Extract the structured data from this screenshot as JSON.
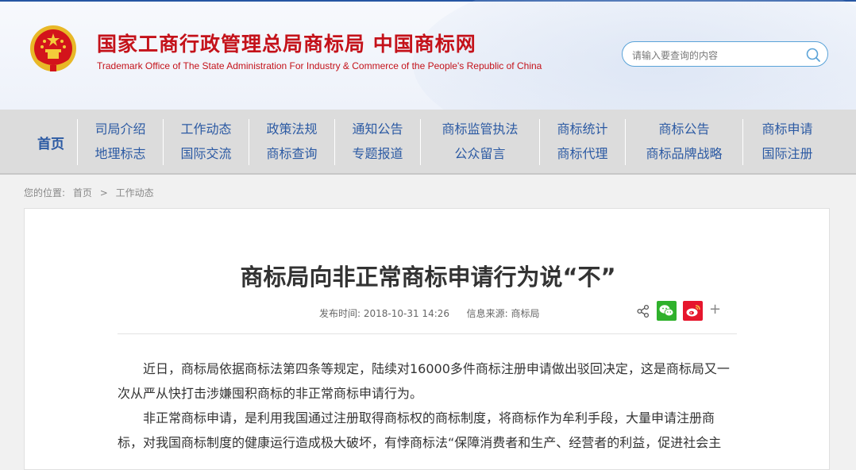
{
  "header": {
    "title": "国家工商行政管理总局商标局 中国商标网",
    "subtitle": "Trademark Office of The State Administration For Industry & Commerce of the People's Republic of China",
    "search_placeholder": "请输入要查询的内容",
    "brand_color": "#c4121a",
    "search_border_color": "#5aa3d8"
  },
  "nav": {
    "home": "首页",
    "columns": [
      {
        "top": "司局介绍",
        "bottom": "地理标志"
      },
      {
        "top": "工作动态",
        "bottom": "国际交流"
      },
      {
        "top": "政策法规",
        "bottom": "商标查询"
      },
      {
        "top": "通知公告",
        "bottom": "专题报道"
      },
      {
        "top": "商标监管执法",
        "bottom": "公众留言"
      },
      {
        "top": "商标统计",
        "bottom": "商标代理"
      },
      {
        "top": "商标公告",
        "bottom": "商标品牌战略"
      },
      {
        "top": "商标申请",
        "bottom": "国际注册"
      }
    ],
    "link_color": "#2c5aa3"
  },
  "breadcrumb": {
    "label": "您的位置:",
    "home": "首页",
    "separator": ">",
    "current": "工作动态"
  },
  "article": {
    "title": "商标局向非正常商标申请行为说“不”",
    "published_label": "发布时间:",
    "published_value": "2018-10-31 14:26",
    "source_label": "信息来源:",
    "source_value": "商标局",
    "share_icons": [
      "share-icon",
      "wechat-icon",
      "weibo-icon",
      "more-icon"
    ],
    "more_label": "+",
    "paragraphs": [
      "近日，商标局依据商标法第四条等规定，陆续对16000多件商标注册申请做出驳回决定，这是商标局又一次从严从快打击涉嫌囤积商标的非正常商标申请行为。",
      "非正常商标申请，是利用我国通过注册取得商标权的商标制度，将商标作为牟利手段，大量申请注册商标，对我国商标制度的健康运行造成极大破坏，有悖商标法“保障消费者和生产、经营者的利益，促进社会主"
    ]
  }
}
